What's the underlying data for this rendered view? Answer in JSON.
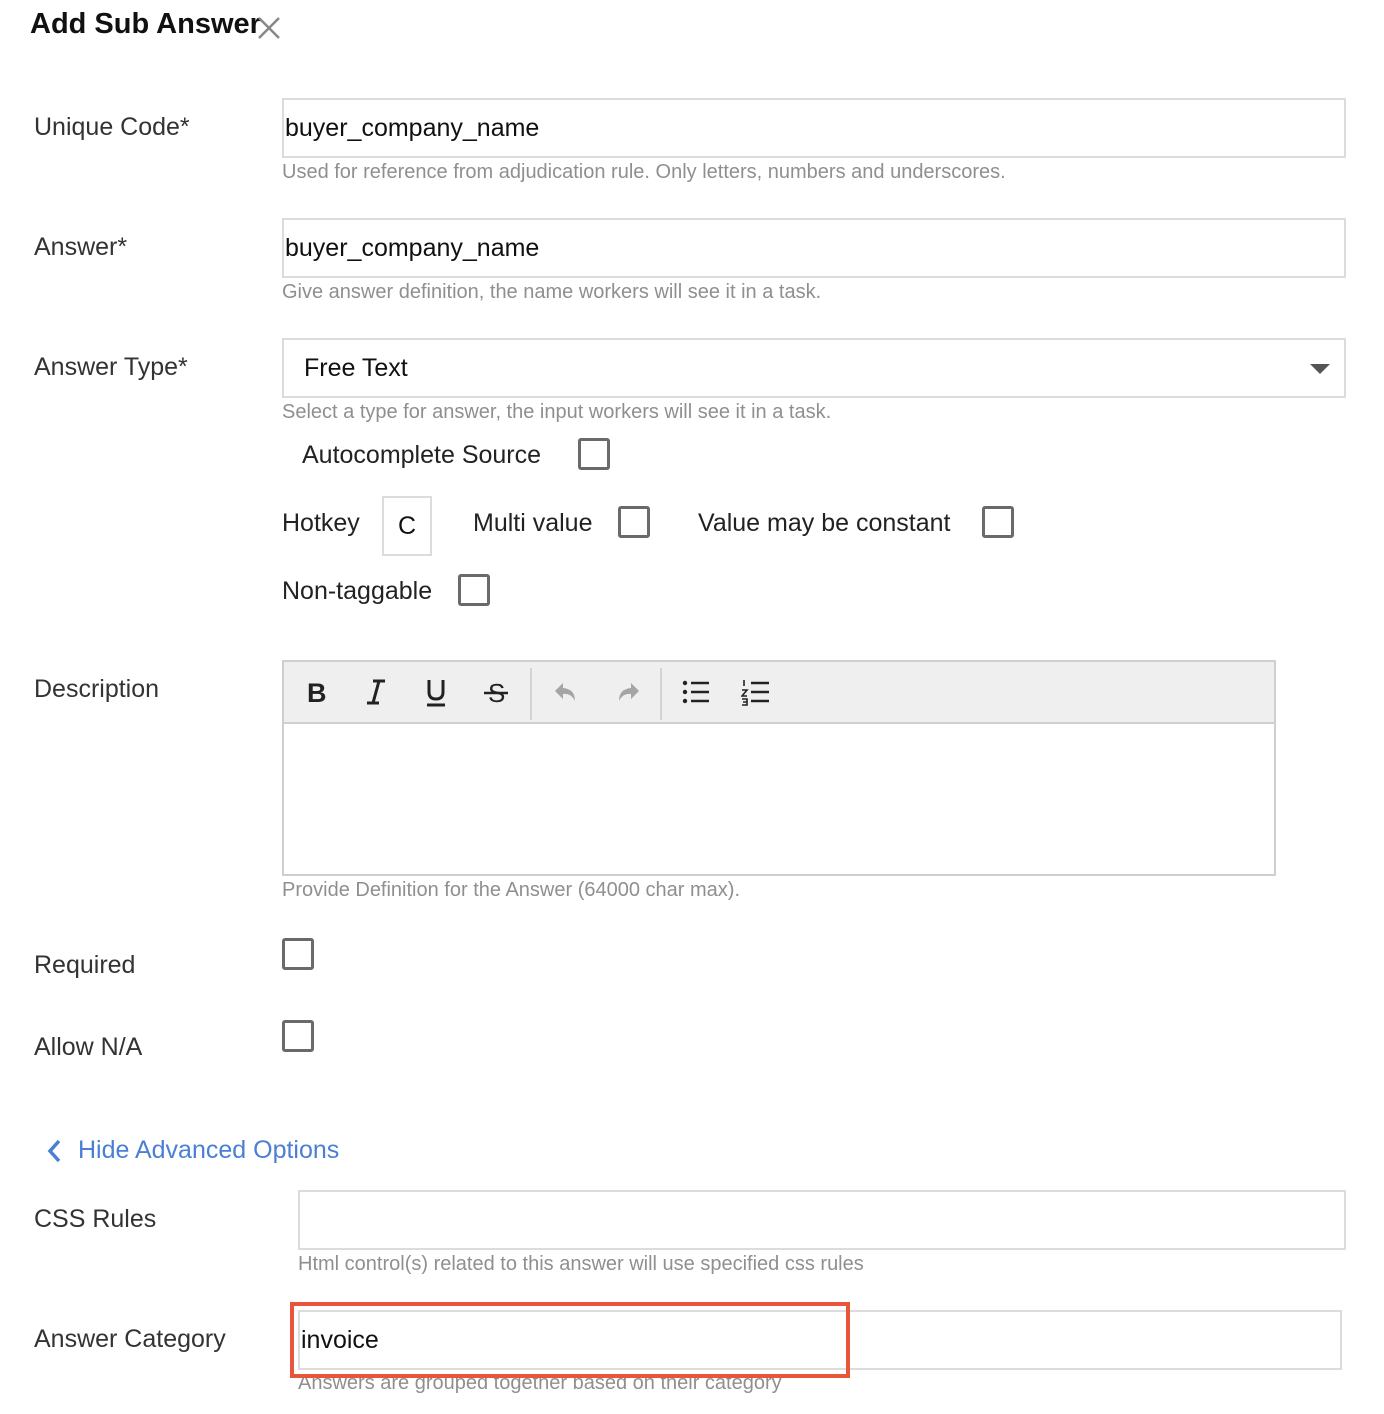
{
  "dialog": {
    "title": "Add Sub Answer",
    "close_icon": "close-icon"
  },
  "unique_code": {
    "label": "Unique Code*",
    "value": "buyer_company_name",
    "help": "Used for reference from adjudication rule. Only letters, numbers and underscores."
  },
  "answer": {
    "label": "Answer*",
    "value": "buyer_company_name",
    "help": "Give answer definition, the name workers will see it in a task."
  },
  "answer_type": {
    "label": "Answer Type*",
    "selected": "Free Text",
    "help": "Select a type for answer, the input workers will see it in a task."
  },
  "options": {
    "autocomplete_label": "Autocomplete Source",
    "hotkey_label": "Hotkey",
    "hotkey_value": "C",
    "multi_value_label": "Multi value",
    "constant_label": "Value may be constant",
    "non_taggable_label": "Non-taggable"
  },
  "description": {
    "label": "Description",
    "toolbar": [
      "bold-icon",
      "italic-icon",
      "underline-icon",
      "strikethrough-icon",
      "undo-icon",
      "redo-icon",
      "bullet-list-icon",
      "numbered-list-icon"
    ],
    "help": "Provide Definition for the Answer (64000 char max)."
  },
  "required": {
    "label": "Required"
  },
  "allow_na": {
    "label": "Allow N/A"
  },
  "advanced": {
    "toggle_label": "Hide Advanced Options",
    "icon": "chevron-left-icon"
  },
  "css_rules": {
    "label": "CSS Rules",
    "value": "",
    "help": "Html control(s) related to this answer will use specified css rules"
  },
  "answer_category": {
    "label": "Answer Category",
    "value": "invoice",
    "help": "Answers are grouped together based on their category"
  },
  "colors": {
    "link": "#4a7fd4",
    "highlight": "#e8553c",
    "help_text": "#8f8f8f"
  }
}
